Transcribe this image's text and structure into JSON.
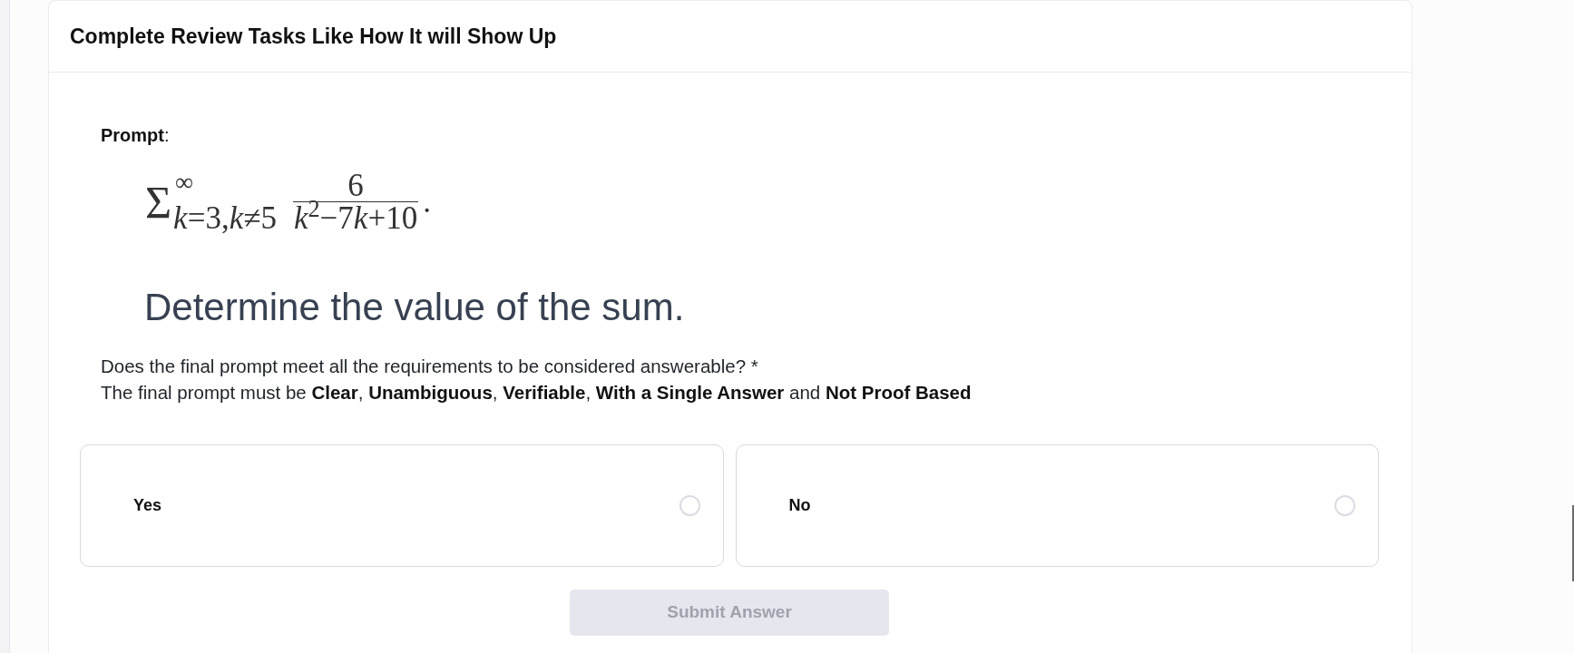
{
  "header": {
    "title": "Complete Review Tasks Like How It will Show Up"
  },
  "prompt": {
    "label": "**Prompt**:",
    "formula": {
      "symbol": "Σ",
      "upper": "∞",
      "lower": "*k*=3,*k*≠5",
      "numerator": "6",
      "denominator": [
        "*k*$^{2}$−7",
        "*k*",
        "+10"
      ],
      "trailing": "."
    },
    "text": "Determine the value of the sum."
  },
  "question": {
    "text": "Does the final prompt meet all the requirements to be considered answerable? *",
    "requirements": "The final prompt must be **Clear**, **Unambiguous**, **Verifiable**, **With a Single Answer** and **Not Proof Based**"
  },
  "options": [
    {
      "label": "Yes",
      "selected": false
    },
    {
      "label": "No",
      "selected": false
    }
  ],
  "submit": {
    "label": "Submit Answer",
    "disabled": true
  }
}
